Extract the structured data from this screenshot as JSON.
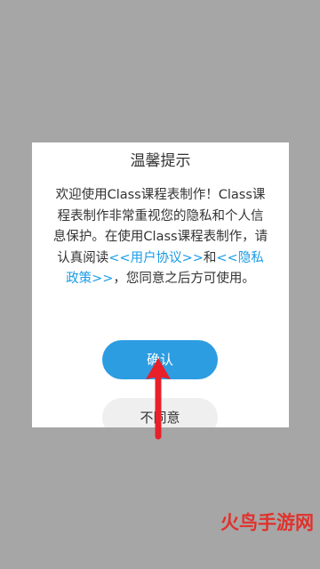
{
  "dialog": {
    "title": "温馨提示",
    "message": {
      "intro": "欢迎使用Class课程表制作！Class课程表制作非常重视您的隐私和个人信息保护。在使用Class课程表制作，请认真阅读",
      "user_agreement_link": "<<用户协议>>",
      "connector": "和",
      "privacy_policy_link": "<<隐私政策>>",
      "outro": "，您同意之后方可使用。"
    },
    "confirm_label": "确认",
    "decline_label": "不同意"
  },
  "watermark": {
    "text": "火鸟手游网"
  },
  "colors": {
    "overlay": "#a6a6a6",
    "accent": "#2d9de2",
    "link": "#1a9be6",
    "arrow": "#e8202a",
    "watermark": "#e1312c"
  }
}
